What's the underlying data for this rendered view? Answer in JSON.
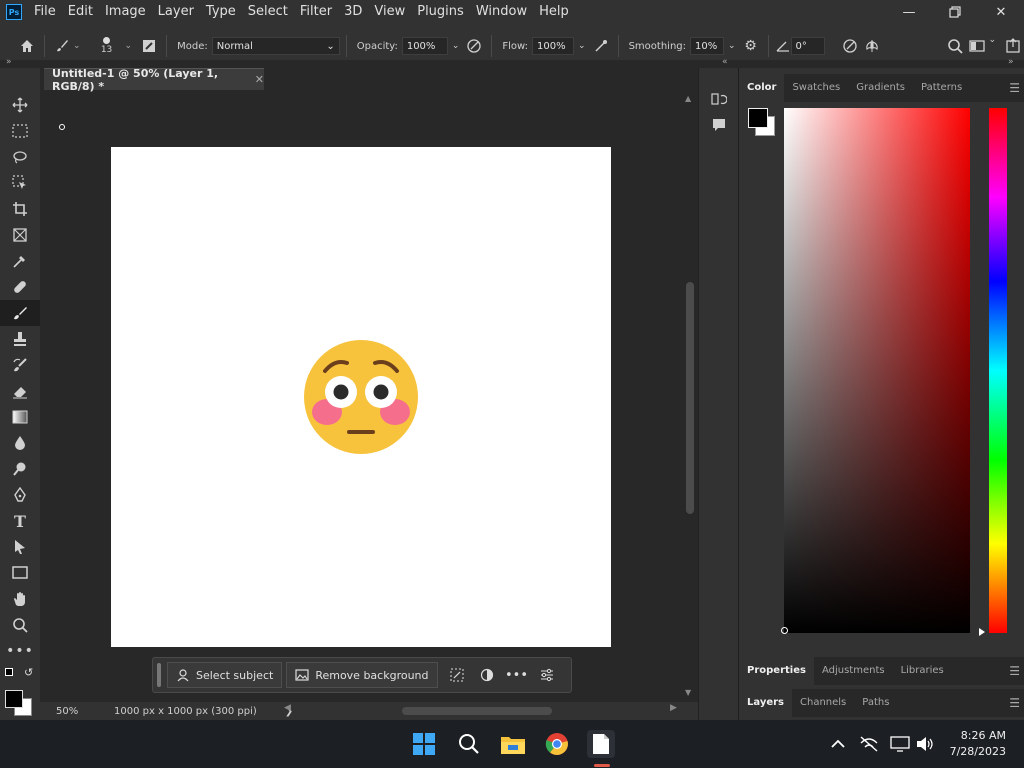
{
  "menubar": {
    "logo": "Ps",
    "items": [
      "File",
      "Edit",
      "Image",
      "Layer",
      "Type",
      "Select",
      "Filter",
      "3D",
      "View",
      "Plugins",
      "Window",
      "Help"
    ]
  },
  "options": {
    "brush_size": "13",
    "mode_label": "Mode:",
    "mode_value": "Normal",
    "opacity_label": "Opacity:",
    "opacity_value": "100%",
    "flow_label": "Flow:",
    "flow_value": "100%",
    "smoothing_label": "Smoothing:",
    "smoothing_value": "10%",
    "angle_value": "0°"
  },
  "document": {
    "tab_title": "Untitled-1 @ 50% (Layer 1, RGB/8) *",
    "zoom": "50%",
    "doc_info": "1000 px x 1000 px (300 ppi)"
  },
  "context_bar": {
    "select_subject": "Select subject",
    "remove_background": "Remove background"
  },
  "color_panel": {
    "tabs": [
      "Color",
      "Swatches",
      "Gradients",
      "Patterns"
    ],
    "foreground": "#000000",
    "background": "#ffffff",
    "hue_color": "#ff0000"
  },
  "properties_panel": {
    "tabs": [
      "Properties",
      "Adjustments",
      "Libraries"
    ]
  },
  "layers_panel": {
    "tabs": [
      "Layers",
      "Channels",
      "Paths"
    ]
  },
  "taskbar": {
    "time": "8:26 AM",
    "date": "7/28/2023"
  }
}
